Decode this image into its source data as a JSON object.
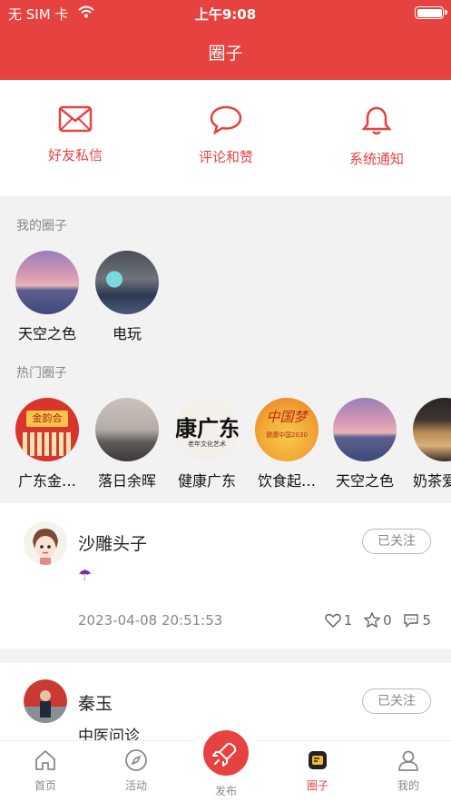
{
  "status_bar": {
    "carrier": "无 SIM 卡",
    "time": "上午9:08"
  },
  "header": {
    "title": "圈子"
  },
  "notifications": [
    {
      "label": "好友私信",
      "icon": "mail-icon"
    },
    {
      "label": "评论和赞",
      "icon": "comment-icon"
    },
    {
      "label": "系统通知",
      "icon": "bell-icon"
    }
  ],
  "my_circles": {
    "title": "我的圈子",
    "items": [
      {
        "name": "天空之色"
      },
      {
        "name": "电玩"
      }
    ]
  },
  "hot_circles": {
    "title": "热门圈子",
    "items": [
      {
        "name": "广东金…",
        "thumb_text": "金韵合"
      },
      {
        "name": "落日余晖"
      },
      {
        "name": "健康广东",
        "thumb_text": "康广东",
        "thumb_sub": "老年文化艺术"
      },
      {
        "name": "饮食起…",
        "thumb_text": "中国梦",
        "thumb_sub": "健康中国2030"
      },
      {
        "name": "天空之色"
      },
      {
        "name": "奶茶爱"
      }
    ]
  },
  "posts": [
    {
      "username": "沙雕头子",
      "follow_label": "已关注",
      "content": "☂",
      "time": "2023-04-08 20:51:53",
      "likes": "1",
      "favorites": "0",
      "comments": "5"
    },
    {
      "username": "秦玉",
      "follow_label": "已关注",
      "content": "中医问诊"
    }
  ],
  "tabbar": {
    "items": [
      {
        "label": "首页",
        "icon": "home-icon"
      },
      {
        "label": "活动",
        "icon": "compass-icon"
      },
      {
        "label": "发布",
        "icon": "rocket-icon"
      },
      {
        "label": "圈子",
        "icon": "circle-tab-icon",
        "active": true
      },
      {
        "label": "我的",
        "icon": "user-icon"
      }
    ]
  },
  "colors": {
    "accent": "#e64340",
    "background": "#f2f2f2",
    "muted": "#888888"
  }
}
